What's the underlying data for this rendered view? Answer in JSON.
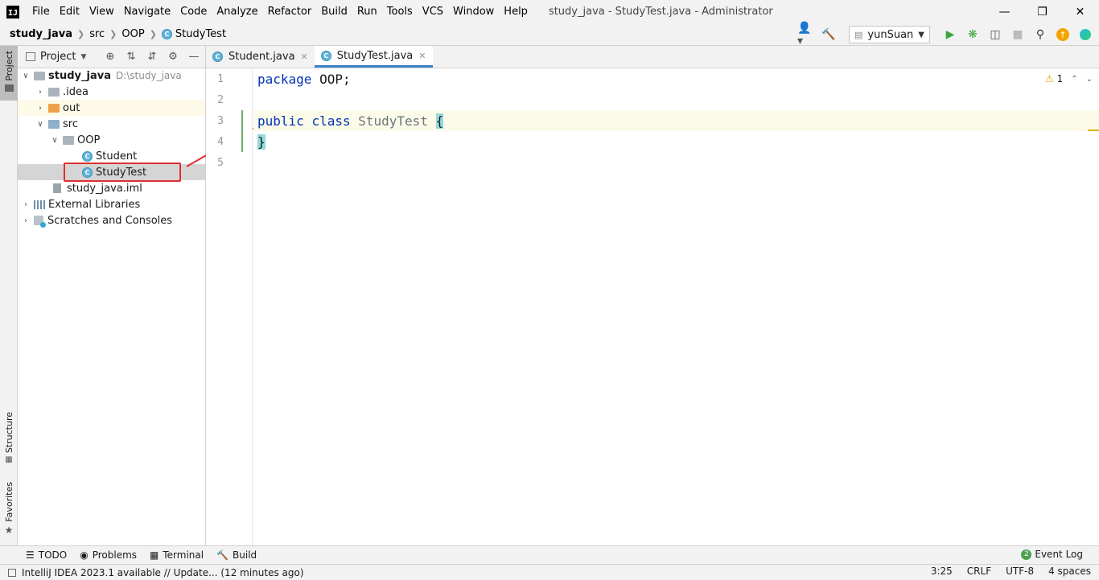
{
  "app": {
    "logo": "IJ",
    "window_title": "study_java - StudyTest.java - Administrator"
  },
  "menu": [
    "File",
    "Edit",
    "View",
    "Navigate",
    "Code",
    "Analyze",
    "Refactor",
    "Build",
    "Run",
    "Tools",
    "VCS",
    "Window",
    "Help"
  ],
  "breadcrumb": {
    "project": "study_java",
    "src": "src",
    "package": "OOP",
    "class": "StudyTest"
  },
  "toolbar": {
    "run_config": "yunSuan"
  },
  "side_tabs": {
    "project": "Project",
    "structure": "Structure",
    "favorites": "Favorites"
  },
  "project_panel": {
    "title": "Project",
    "root_name": "study_java",
    "root_path": "D:\\study_java",
    "idea": ".idea",
    "out": "out",
    "src": "src",
    "oop": "OOP",
    "student": "Student",
    "studytest": "StudyTest",
    "iml": "study_java.iml",
    "external": "External Libraries",
    "scratches": "Scratches and Consoles"
  },
  "tabs": {
    "student": "Student.java",
    "studytest": "StudyTest.java"
  },
  "editor": {
    "line_numbers": [
      "1",
      "2",
      "3",
      "4",
      "5"
    ],
    "kw_package": "package",
    "pkg_name": " OOP;",
    "kw_public": "public",
    "kw_class": "class",
    "class_name": "StudyTest",
    "open_brace": "{",
    "close_brace": "}",
    "warnings": "1"
  },
  "bottom_tools": {
    "todo": "TODO",
    "problems": "Problems",
    "terminal": "Terminal",
    "build": "Build",
    "event_log": "Event Log",
    "event_count": "2"
  },
  "status": {
    "message": "IntelliJ IDEA 2023.1 available // Update... (12 minutes ago)",
    "position": "3:25",
    "line_sep": "CRLF",
    "encoding": "UTF-8",
    "indent": "4 spaces"
  },
  "colors": {
    "keyword": "#0033b3",
    "class_icon": "#62b4d9",
    "annotation": "#e03030",
    "caret_line": "#fcfae9"
  }
}
